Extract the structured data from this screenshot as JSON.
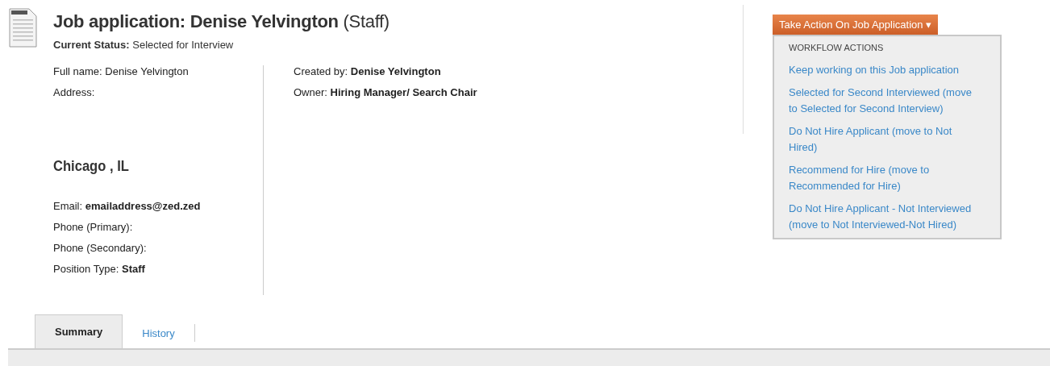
{
  "header": {
    "title": "Job application: Denise Yelvington",
    "title_suffix": "(Staff)",
    "status_label": "Current Status:",
    "status": "Selected for Interview"
  },
  "left_fields": [
    {
      "label": "Full name:",
      "value": "Denise Yelvington",
      "bold": false
    },
    {
      "label": "Address:"
    }
  ],
  "city": "Chicago , IL",
  "contact_fields": [
    {
      "label": "Email:",
      "value": "emailaddress@zed.zed",
      "bold": true
    },
    {
      "label": "Phone (Primary):"
    },
    {
      "label": "Phone (Secondary):"
    },
    {
      "label": "Position Type:",
      "value": "Staff",
      "bold": true
    }
  ],
  "right_fields": [
    {
      "label": "Created by:",
      "value": "Denise Yelvington",
      "bold": true
    },
    {
      "label": "Owner:",
      "value": "Hiring Manager/ Search Chair",
      "bold": true
    }
  ],
  "action_button": {
    "label": "Take Action On Job Application",
    "caret": "▾"
  },
  "menu": {
    "heading": "WORKFLOW ACTIONS",
    "items": [
      "Keep working on this Job application",
      "Selected for Second Interviewed (move to Selected for Second Interview)",
      "Do Not Hire Applicant (move to Not Hired)",
      "Recommend for Hire (move to Recommended for Hire)",
      "Do Not Hire Applicant - Not Interviewed (move to Not Interviewed-Not Hired)"
    ]
  },
  "tabs": [
    {
      "label": "Summary",
      "selected": true
    },
    {
      "label": "History",
      "selected": false
    }
  ]
}
